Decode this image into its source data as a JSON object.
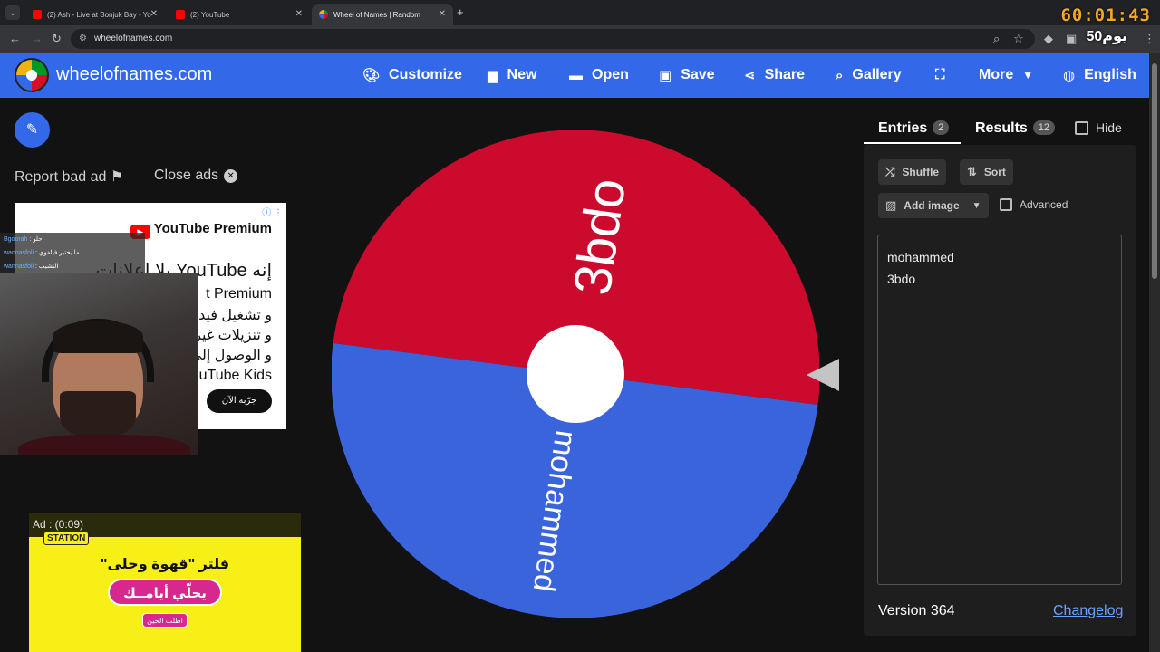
{
  "browser": {
    "tabs": [
      {
        "title": "(2) Ash - Live at Bonjuk Bay - Yo",
        "active": false
      },
      {
        "title": "(2) YouTube",
        "active": false
      },
      {
        "title": "Wheel of Names | Random",
        "active": true
      }
    ],
    "url": "wheelofnames.com",
    "clock": "60:01:43",
    "day_label": "يوم50"
  },
  "header": {
    "site_title": "wheelofnames.com",
    "menu": {
      "customize": "Customize",
      "new": "New",
      "open": "Open",
      "save": "Save",
      "share": "Share",
      "gallery": "Gallery",
      "more": "More",
      "language": "English"
    }
  },
  "ads": {
    "report": "Report bad ad",
    "close": "Close ads",
    "yt_premium": {
      "brand": "YouTube Premium",
      "headline": "إنه YouTube بلا إعلانات",
      "lines": [
        "t Premium",
        "و تشغيل فيد",
        "و تنزيلات غير",
        "و الوصول إلى",
        "uTube Kids و"
      ],
      "cta": "جرّبه الآن"
    },
    "chat": [
      {
        "name": "Bgoorah",
        "msg": "حلو"
      },
      {
        "name": "wannasfoli",
        "msg": "ما يختبر فيلفوي"
      },
      {
        "name": "wannasfoli",
        "msg": "التشيب"
      }
    ],
    "second": {
      "timer": "Ad : (0:09)",
      "brand": "STATION",
      "headline": "فلتر \"قهوة وحلى\"",
      "pill": "يحلّي أيامــك",
      "cta": "اطلب الحين"
    }
  },
  "wheel": {
    "colors": {
      "segment_1": "#cc0a2d",
      "segment_2": "#3a64dc"
    },
    "segments": [
      {
        "label": "3bdo",
        "color": "#cc0a2d"
      },
      {
        "label": "mohammed",
        "color": "#3a64dc"
      }
    ]
  },
  "panel": {
    "entries_tab": "Entries",
    "entries_count": "2",
    "results_tab": "Results",
    "results_count": "12",
    "hide_label": "Hide",
    "shuffle": "Shuffle",
    "sort": "Sort",
    "add_image": "Add image",
    "advanced": "Advanced",
    "entries_lines": [
      "mohammed",
      "3bdo"
    ],
    "version": "Version 364",
    "changelog": "Changelog"
  }
}
